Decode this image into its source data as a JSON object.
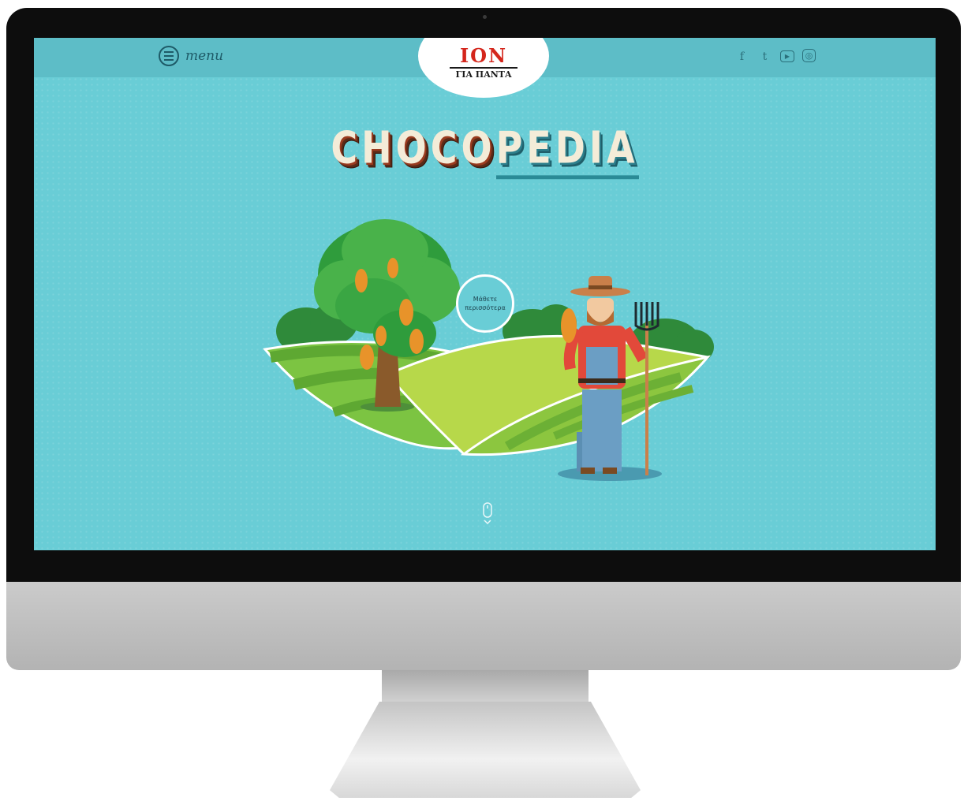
{
  "header": {
    "menu_label": "menu",
    "logo_brand": "ΙΟΝ",
    "logo_tagline": "ΓΙΑ ΠΑΝΤΑ",
    "social": [
      {
        "icon": "facebook-icon",
        "glyph": "f"
      },
      {
        "icon": "tumblr-icon",
        "glyph": "t"
      },
      {
        "icon": "youtube-icon",
        "glyph": "▶"
      },
      {
        "icon": "instagram-icon",
        "glyph": "◎"
      }
    ]
  },
  "hero": {
    "title_part1": "CHOCO",
    "title_part2": "PEDIA",
    "learn_more": "Μάθετε περισσότερα"
  },
  "colors": {
    "background": "#69cdd6",
    "topbar": "#5dbdc7",
    "brand_red": "#d4261c",
    "monitor_bezel": "#0d0d0d",
    "monitor_body": "#bdbdbd"
  }
}
